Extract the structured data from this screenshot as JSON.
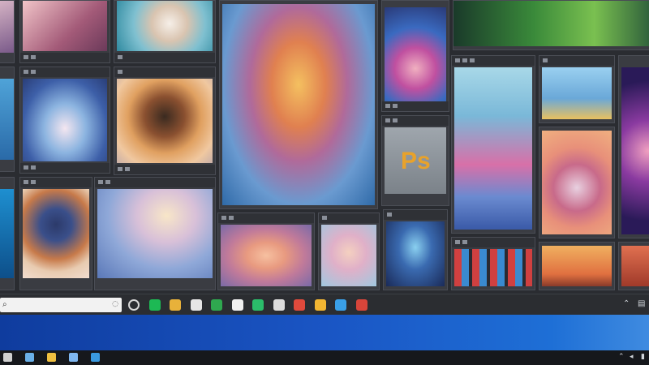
{
  "gallery": {
    "ps_tile": {
      "logo_text": "Ps"
    }
  },
  "taskbar": {
    "search": {
      "icon": "search-icon",
      "placeholder": ""
    },
    "pinned": [
      {
        "name": "cortana-icon",
        "color": "#d8d8d8"
      },
      {
        "name": "spotify-icon",
        "color": "#1db954"
      },
      {
        "name": "chrome-icon",
        "color": "#e8b13a"
      },
      {
        "name": "store-icon",
        "color": "#e6e6e6"
      },
      {
        "name": "sheets-icon",
        "color": "#2fa84f"
      },
      {
        "name": "files-icon",
        "color": "#f0f0f0"
      },
      {
        "name": "edge-icon",
        "color": "#2bbd6a"
      },
      {
        "name": "notes-icon",
        "color": "#dcdcdc"
      },
      {
        "name": "photos-icon",
        "color": "#e04a3c"
      },
      {
        "name": "maps-icon",
        "color": "#f2b632"
      },
      {
        "name": "mail-icon",
        "color": "#3aa0e8"
      },
      {
        "name": "calendar-icon",
        "color": "#d8453a"
      }
    ]
  },
  "bottombar": {
    "pinned": [
      {
        "name": "windows-icon",
        "color": "#d0d0d0"
      },
      {
        "name": "image-viewer-icon",
        "color": "#6ab0e8"
      },
      {
        "name": "store-bag-icon",
        "color": "#f0c040"
      },
      {
        "name": "folder-icon",
        "color": "#7fb7f0"
      },
      {
        "name": "settings-icon",
        "color": "#3a9ae0"
      }
    ]
  }
}
